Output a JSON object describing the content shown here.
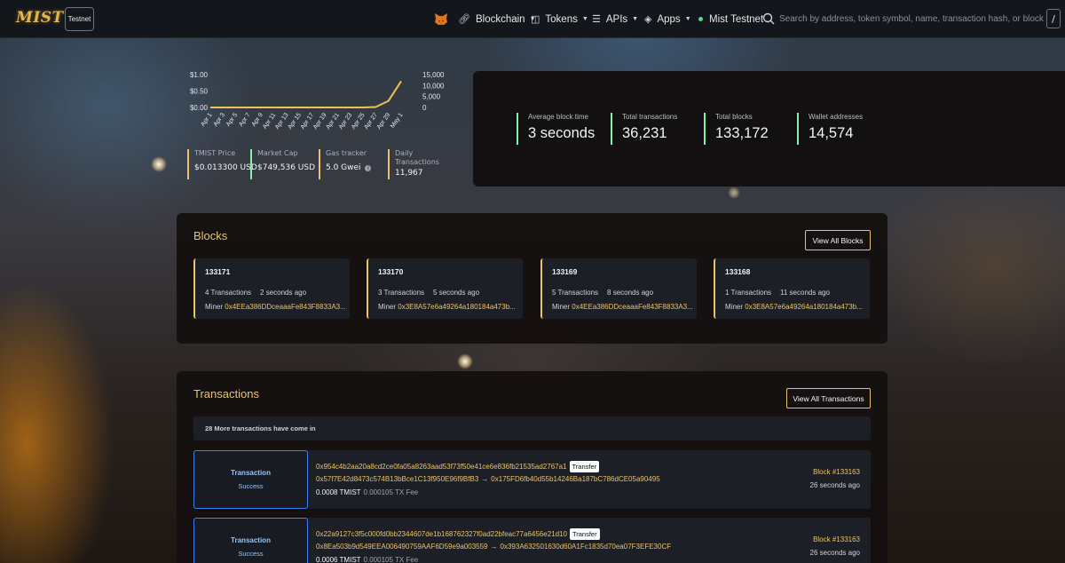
{
  "header": {
    "logo_text": "MIST",
    "network_badge": "Testnet",
    "nav": [
      {
        "label": "Blockchain",
        "icon": "link-icon"
      },
      {
        "label": "Tokens",
        "icon": "coins-icon"
      },
      {
        "label": "APIs",
        "icon": "list-icon"
      },
      {
        "label": "Apps",
        "icon": "layers-icon"
      }
    ],
    "network_status": "Mist Testnet",
    "search_placeholder": "Search by address, token symbol, name, transaction hash, or block number",
    "search_shortcut": "/"
  },
  "chart_data": {
    "type": "line",
    "x": [
      "Apr 1",
      "Apr 3",
      "Apr 5",
      "Apr 7",
      "Apr 9",
      "Apr 11",
      "Apr 13",
      "Apr 15",
      "Apr 17",
      "Apr 19",
      "Apr 21",
      "Apr 23",
      "Apr 25",
      "Apr 27",
      "Apr 29",
      "May 1"
    ],
    "left_axis_ticks": [
      "$1.00",
      "$0.50",
      "$0.00"
    ],
    "right_axis_ticks": [
      "15,000",
      "10,000",
      "5,000",
      "0"
    ],
    "series": [
      {
        "values": [
          0,
          0,
          0,
          0,
          0,
          0,
          0,
          0,
          0,
          0,
          0,
          0,
          0,
          200,
          3000,
          12000
        ],
        "color": "#f2c14e"
      }
    ],
    "ylim_right": [
      0,
      15000
    ]
  },
  "mini_stats": [
    {
      "label": "TMIST Price",
      "value": "$0.013300 USD"
    },
    {
      "label": "Market Cap",
      "value": "$749,536 USD"
    },
    {
      "label": "Gas tracker",
      "value": "5.0 Gwei"
    },
    {
      "label": "Daily Transactions",
      "value": "11,967"
    }
  ],
  "big_stats": [
    {
      "label": "Average block time",
      "value": "3 seconds"
    },
    {
      "label": "Total transactions",
      "value": "36,231"
    },
    {
      "label": "Total blocks",
      "value": "133,172"
    },
    {
      "label": "Wallet addresses",
      "value": "14,574"
    }
  ],
  "blocks": {
    "title": "Blocks",
    "view_all": "View All Blocks",
    "items": [
      {
        "number": "133171",
        "tx_count": "4 Transactions",
        "age": "2 seconds ago",
        "miner_label": "Miner",
        "miner": "0x4EEa386DDceaaaFe843F8833A3..."
      },
      {
        "number": "133170",
        "tx_count": "3 Transactions",
        "age": "5 seconds ago",
        "miner_label": "Miner",
        "miner": "0x3E8A57e6a49264a180184a473b..."
      },
      {
        "number": "133169",
        "tx_count": "5 Transactions",
        "age": "8 seconds ago",
        "miner_label": "Miner",
        "miner": "0x4EEa386DDceaaaFe843F8833A3..."
      },
      {
        "number": "133168",
        "tx_count": "1 Transactions",
        "age": "11 seconds ago",
        "miner_label": "Miner",
        "miner": "0x3E8A57e6a49264a180184a473b..."
      }
    ]
  },
  "transactions": {
    "title": "Transactions",
    "view_all": "View All Transactions",
    "notice": "28 More transactions have come in",
    "items": [
      {
        "type": "Transaction",
        "status": "Success",
        "hash": "0x954c4b2aa20a8cd2ce0fa05a8263aad53f73f50e41ce6e836fb21535ad2767a1",
        "tag": "Transfer",
        "from": "0x57f7E42d8473c574B13bBce1C13f950E96f9BfB3",
        "to": "0x175FD6fb40d55b14246Ba187bC786dCE05a90495",
        "amount": "0.0008 TMIST",
        "fee": "0.000105 TX Fee",
        "block": "Block #133163",
        "age": "26 seconds ago"
      },
      {
        "type": "Transaction",
        "status": "Success",
        "hash": "0x22a9127c3f5c000fd0bb2344607de1b168762327f0ad22bfeac77a6456e21d10",
        "tag": "Transfer",
        "from": "0x8Ea503b9d549EEA006490759AAF6D59e9a003559",
        "to": "0x393A632501630d60A1Fc1835d70ea07F3EFE30CF",
        "amount": "0.0006 TMIST",
        "fee": "0.000105 TX Fee",
        "block": "Block #133163",
        "age": "26 seconds ago"
      }
    ]
  }
}
